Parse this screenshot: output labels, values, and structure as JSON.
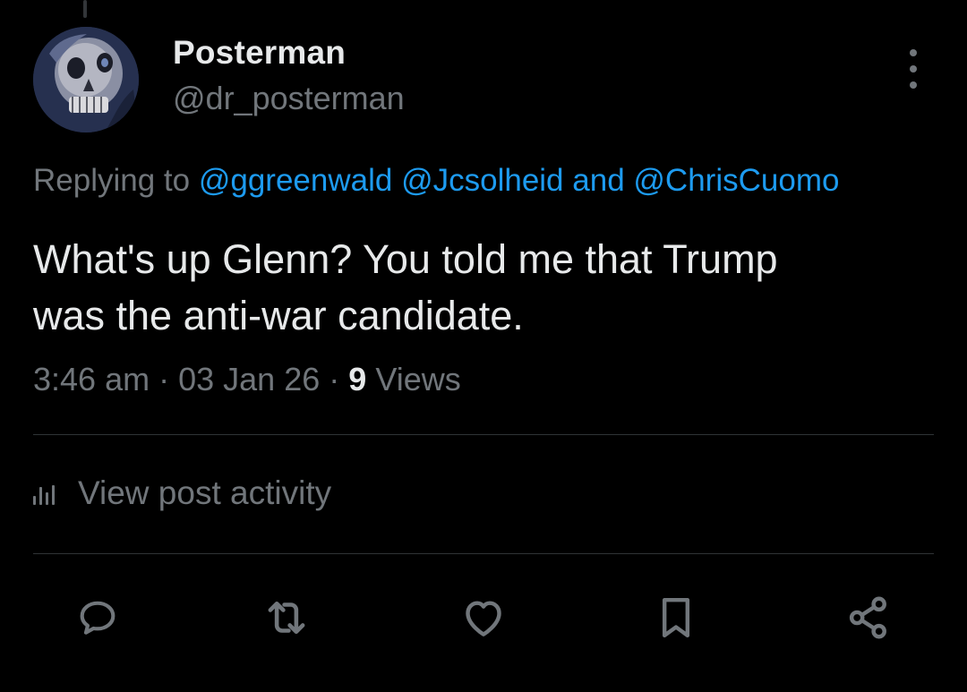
{
  "post": {
    "display_name": "Posterman",
    "handle": "@dr_posterman",
    "replying_prefix": "Replying to",
    "mentions": [
      "@ggreenwald",
      "@Jcsolheid"
    ],
    "mention_joiner": "and",
    "last_mention": "@ChrisCuomo",
    "text_line1": "What's up Glenn? You told me that Trump",
    "text_line2": "was the anti-war candidate.",
    "time": "3:46 am",
    "separator": "·",
    "date": "03 Jan 26",
    "views_count": "9",
    "views_label": "Views"
  },
  "activity": {
    "label": "View post activity"
  },
  "actions": {
    "icons": [
      "reply-icon",
      "repost-icon",
      "like-icon",
      "bookmark-icon",
      "share-icon"
    ]
  },
  "colors": {
    "background": "#000000",
    "text": "#e7e9ea",
    "secondary": "#71767b",
    "accent": "#1d9bf0",
    "divider": "#2f3336"
  }
}
